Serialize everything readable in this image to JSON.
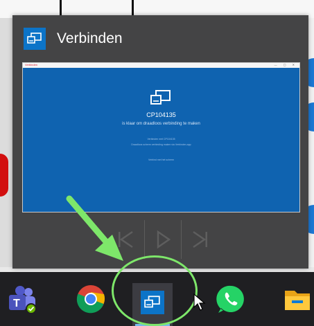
{
  "popup": {
    "title": "Verbinden",
    "preview": {
      "window_title": "Verbinden",
      "device_name": "CP104135",
      "instruction": "is klaar om draadloos verbinding te maken",
      "detail_1": "Verbinden met CP104135",
      "detail_2": "Draadloos scherm verbinding maken via Verbinden-app",
      "detail_3": "Verbind met het scherm"
    }
  },
  "media_controls": [
    "previous",
    "play",
    "next"
  ],
  "taskbar": {
    "apps": [
      {
        "name": "Microsoft Teams",
        "icon": "teams-icon"
      },
      {
        "name": "Google Chrome",
        "icon": "chrome-icon"
      },
      {
        "name": "Verbinden",
        "icon": "connect-icon",
        "active": true
      },
      {
        "name": "WhatsApp",
        "icon": "whatsapp-icon"
      },
      {
        "name": "File Explorer",
        "icon": "file-explorer-icon"
      }
    ]
  },
  "colors": {
    "accent": "#0c74c8",
    "highlight": "#7ee76a",
    "taskbar": "#1f1f22",
    "popup": "#444445"
  }
}
